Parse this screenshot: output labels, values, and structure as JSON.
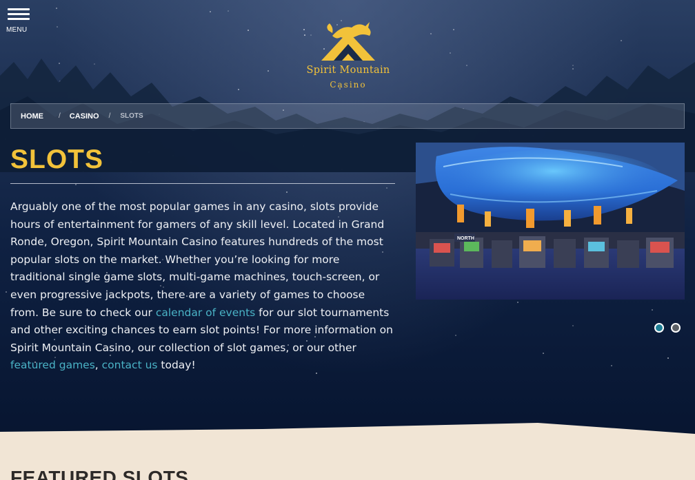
{
  "header": {
    "menu_label": "MENU",
    "logo_line1": "Spirit Mountain",
    "logo_line2": "Casino"
  },
  "breadcrumb": {
    "items": [
      "HOME",
      "CASINO"
    ],
    "separator": "/",
    "current": "SLOTS"
  },
  "main": {
    "title": "SLOTS",
    "paragraph": {
      "part1": "Arguably one of the most popular games in any casino, slots provide hours of entertainment for gamers of any skill level. Located in Grand Ronde, Oregon, Spirit Mountain Casino features hundreds of the most popular slots on the market. Whether you’re looking for more traditional single game slots, multi-game machines, touch-screen, or even progressive jackpots, there are a variety of games to choose from. Be sure to check our ",
      "link1": "calendar of events",
      "part2": " for our slot tournaments and other exciting chances to earn slot points! For more information on Spirit Mountain Casino, our collection of slot games, or our other ",
      "link2": "featured games",
      "part3": ", ",
      "link3": "contact us",
      "part4": " today!"
    }
  },
  "slider": {
    "total_slides": 2,
    "active_index": 0,
    "sign_text": "NORTH"
  },
  "featured": {
    "title": "FEATURED SLOTS"
  },
  "colors": {
    "accent_gold": "#f2c23a",
    "link_teal": "#4ab3c6",
    "band_cream": "#f1e5d5",
    "night_navy": "#0f2142"
  },
  "icons": [
    "hamburger-menu-icon",
    "spirit-mountain-logo"
  ]
}
